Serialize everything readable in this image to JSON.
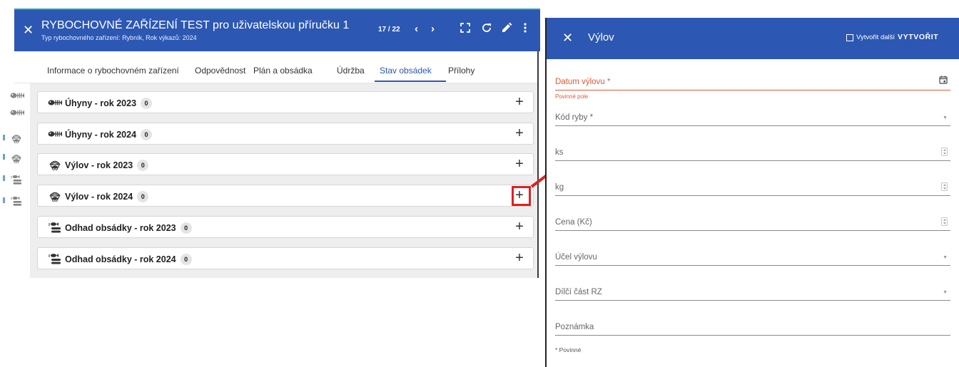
{
  "main_window": {
    "title": "RYBOCHOVNÉ ZAŘÍZENÍ TEST pro uživatelskou příručku 1",
    "subtitle": "Typ rybochovného zařízení: Rybník, Rok výkazů: 2024",
    "pager": "17 / 22",
    "icons": [
      "close-icon",
      "chevron-left-icon",
      "chevron-right-icon",
      "fullscreen-icon",
      "refresh-icon",
      "edit-icon",
      "more-vert-icon"
    ],
    "tabs": [
      {
        "label": "Informace o rybochovném zařízení",
        "active": false
      },
      {
        "label": "Odpovědnost",
        "active": false
      },
      {
        "label": "Plán a obsádka",
        "active": false
      },
      {
        "label": "Údržba",
        "active": false
      },
      {
        "label": "Stav obsádek",
        "active": true
      },
      {
        "label": "Přílohy",
        "active": false
      }
    ],
    "sections": [
      {
        "label": "Úhyny - rok 2023",
        "count": "0",
        "icon": "dead-fish-icon"
      },
      {
        "label": "Úhyny - rok 2024",
        "count": "0",
        "icon": "dead-fish-icon"
      },
      {
        "label": "Výlov - rok 2023",
        "count": "0",
        "icon": "fishing-net-icon"
      },
      {
        "label": "Výlov - rok 2024",
        "count": "0",
        "icon": "fishing-net-icon"
      },
      {
        "label": "Odhad obsádky - rok 2023",
        "count": "0",
        "icon": "fish-stock-icon"
      },
      {
        "label": "Odhad obsádky - rok 2024",
        "count": "0",
        "icon": "fish-stock-icon"
      }
    ],
    "add_icon": "plus-icon"
  },
  "dialog": {
    "title": "Výlov",
    "create_another_label": "Vytvořit další",
    "create_another_checked": false,
    "create_button": "VYTVOŘIT",
    "fields": [
      {
        "label": "Datum výlovu *",
        "type": "date",
        "error": "Povinné pole"
      },
      {
        "label": "Kód ryby *",
        "type": "select"
      },
      {
        "label": "ks",
        "type": "number"
      },
      {
        "label": "kg",
        "type": "number"
      },
      {
        "label": "Cena (Kč)",
        "type": "number"
      },
      {
        "label": "Účel výlovu",
        "type": "select"
      },
      {
        "label": "Dílčí část RZ",
        "type": "select"
      },
      {
        "label": "Poznámka",
        "type": "text"
      }
    ],
    "required_note": "* Povinné"
  },
  "colors": {
    "header_blue": "#2c57b3",
    "error_red": "#e05a3a",
    "highlight_red": "#e02020",
    "content_bg": "#eeeeee"
  }
}
